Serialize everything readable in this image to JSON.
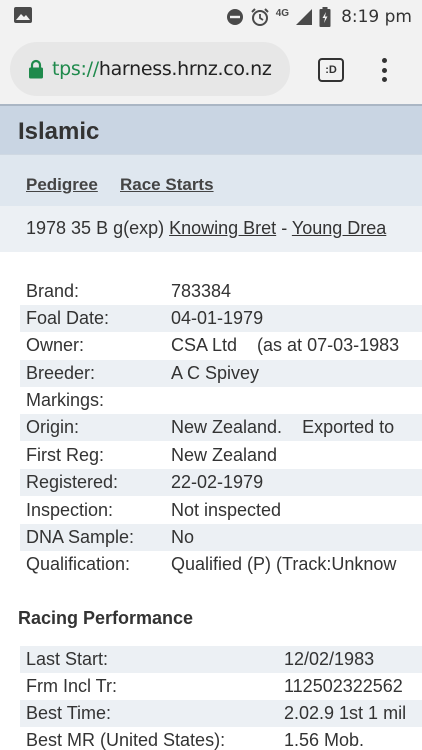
{
  "status_bar": {
    "time": "8:19 pm",
    "network": "4G",
    "icons": [
      "gallery-icon",
      "do-not-disturb-icon",
      "alarm-icon",
      "signal-icon",
      "battery-icon"
    ]
  },
  "browser": {
    "url_scheme": "tps://",
    "url_host": "harness.hrnz.co.nz",
    "tabs_label": ":D"
  },
  "page": {
    "title": "Islamic",
    "tabs": [
      {
        "label": "Pedigree"
      },
      {
        "label": "Race Starts"
      }
    ],
    "summary": {
      "prefix": "1978 35 B g(exp)",
      "sire": "Knowing Bret",
      "separator": "-",
      "dam": "Young Drea"
    },
    "details": [
      {
        "label": "Brand:",
        "value": "783384"
      },
      {
        "label": "Foal Date:",
        "value": "04-01-1979"
      },
      {
        "label": "Owner:",
        "value": "CSA Ltd    (as at 07-03-1983"
      },
      {
        "label": "Breeder:",
        "value": "A C Spivey"
      },
      {
        "label": "Markings:",
        "value": ""
      },
      {
        "label": "Origin:",
        "value": "New Zealand.    Exported to"
      },
      {
        "label": "First Reg:",
        "value": "New Zealand"
      },
      {
        "label": "Registered:",
        "value": "22-02-1979"
      },
      {
        "label": "Inspection:",
        "value": "Not inspected"
      },
      {
        "label": "DNA Sample:",
        "value": "No"
      },
      {
        "label": "Qualification:",
        "value": "Qualified (P) (Track:Unknow"
      }
    ],
    "racing_title": "Racing Performance",
    "racing": [
      {
        "label": "Last Start:",
        "value": "12/02/1983"
      },
      {
        "label": "Frm Incl Tr:",
        "value": "112502322562"
      },
      {
        "label": "Best Time:",
        "value": "2.02.9 1st 1 mil"
      },
      {
        "label": "Best MR (United States):",
        "value": "1.56 Mob."
      }
    ]
  }
}
